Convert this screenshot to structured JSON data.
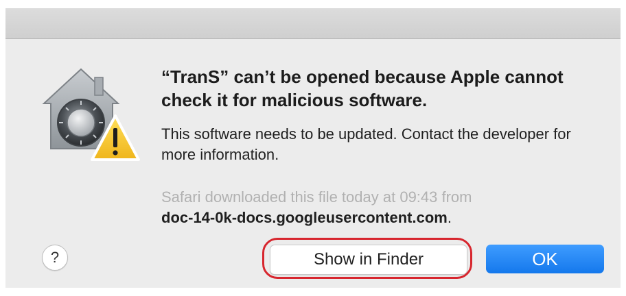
{
  "dialog": {
    "headline": "“TranS” can’t be opened because Apple cannot check it for malicious software.",
    "body": "This software needs to be updated. Contact the developer for more information.",
    "download_meta": "Safari downloaded this file today at 09:43 from",
    "download_domain": "doc-14-0k-docs.googleusercontent.com",
    "download_period": "."
  },
  "buttons": {
    "help_label": "?",
    "show_in_finder_label": "Show in Finder",
    "ok_label": "OK"
  },
  "icons": {
    "app_icon": "gatekeeper-lock-house-icon",
    "warning_icon": "warning-triangle-icon"
  },
  "colors": {
    "accent_button": "#1478ec",
    "highlight": "#d7262e",
    "warning": "#f3c12b"
  }
}
